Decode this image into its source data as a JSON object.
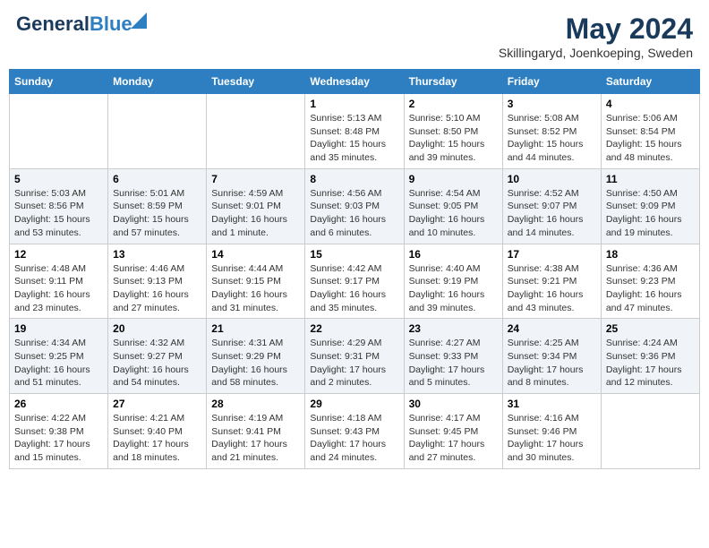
{
  "header": {
    "logo_general": "General",
    "logo_blue": "Blue",
    "month_title": "May 2024",
    "location": "Skillingaryd, Joenkoeping, Sweden"
  },
  "weekdays": [
    "Sunday",
    "Monday",
    "Tuesday",
    "Wednesday",
    "Thursday",
    "Friday",
    "Saturday"
  ],
  "weeks": [
    [
      {
        "day": "",
        "sunrise": "",
        "sunset": "",
        "daylight": ""
      },
      {
        "day": "",
        "sunrise": "",
        "sunset": "",
        "daylight": ""
      },
      {
        "day": "",
        "sunrise": "",
        "sunset": "",
        "daylight": ""
      },
      {
        "day": "1",
        "sunrise": "Sunrise: 5:13 AM",
        "sunset": "Sunset: 8:48 PM",
        "daylight": "Daylight: 15 hours and 35 minutes."
      },
      {
        "day": "2",
        "sunrise": "Sunrise: 5:10 AM",
        "sunset": "Sunset: 8:50 PM",
        "daylight": "Daylight: 15 hours and 39 minutes."
      },
      {
        "day": "3",
        "sunrise": "Sunrise: 5:08 AM",
        "sunset": "Sunset: 8:52 PM",
        "daylight": "Daylight: 15 hours and 44 minutes."
      },
      {
        "day": "4",
        "sunrise": "Sunrise: 5:06 AM",
        "sunset": "Sunset: 8:54 PM",
        "daylight": "Daylight: 15 hours and 48 minutes."
      }
    ],
    [
      {
        "day": "5",
        "sunrise": "Sunrise: 5:03 AM",
        "sunset": "Sunset: 8:56 PM",
        "daylight": "Daylight: 15 hours and 53 minutes."
      },
      {
        "day": "6",
        "sunrise": "Sunrise: 5:01 AM",
        "sunset": "Sunset: 8:59 PM",
        "daylight": "Daylight: 15 hours and 57 minutes."
      },
      {
        "day": "7",
        "sunrise": "Sunrise: 4:59 AM",
        "sunset": "Sunset: 9:01 PM",
        "daylight": "Daylight: 16 hours and 1 minute."
      },
      {
        "day": "8",
        "sunrise": "Sunrise: 4:56 AM",
        "sunset": "Sunset: 9:03 PM",
        "daylight": "Daylight: 16 hours and 6 minutes."
      },
      {
        "day": "9",
        "sunrise": "Sunrise: 4:54 AM",
        "sunset": "Sunset: 9:05 PM",
        "daylight": "Daylight: 16 hours and 10 minutes."
      },
      {
        "day": "10",
        "sunrise": "Sunrise: 4:52 AM",
        "sunset": "Sunset: 9:07 PM",
        "daylight": "Daylight: 16 hours and 14 minutes."
      },
      {
        "day": "11",
        "sunrise": "Sunrise: 4:50 AM",
        "sunset": "Sunset: 9:09 PM",
        "daylight": "Daylight: 16 hours and 19 minutes."
      }
    ],
    [
      {
        "day": "12",
        "sunrise": "Sunrise: 4:48 AM",
        "sunset": "Sunset: 9:11 PM",
        "daylight": "Daylight: 16 hours and 23 minutes."
      },
      {
        "day": "13",
        "sunrise": "Sunrise: 4:46 AM",
        "sunset": "Sunset: 9:13 PM",
        "daylight": "Daylight: 16 hours and 27 minutes."
      },
      {
        "day": "14",
        "sunrise": "Sunrise: 4:44 AM",
        "sunset": "Sunset: 9:15 PM",
        "daylight": "Daylight: 16 hours and 31 minutes."
      },
      {
        "day": "15",
        "sunrise": "Sunrise: 4:42 AM",
        "sunset": "Sunset: 9:17 PM",
        "daylight": "Daylight: 16 hours and 35 minutes."
      },
      {
        "day": "16",
        "sunrise": "Sunrise: 4:40 AM",
        "sunset": "Sunset: 9:19 PM",
        "daylight": "Daylight: 16 hours and 39 minutes."
      },
      {
        "day": "17",
        "sunrise": "Sunrise: 4:38 AM",
        "sunset": "Sunset: 9:21 PM",
        "daylight": "Daylight: 16 hours and 43 minutes."
      },
      {
        "day": "18",
        "sunrise": "Sunrise: 4:36 AM",
        "sunset": "Sunset: 9:23 PM",
        "daylight": "Daylight: 16 hours and 47 minutes."
      }
    ],
    [
      {
        "day": "19",
        "sunrise": "Sunrise: 4:34 AM",
        "sunset": "Sunset: 9:25 PM",
        "daylight": "Daylight: 16 hours and 51 minutes."
      },
      {
        "day": "20",
        "sunrise": "Sunrise: 4:32 AM",
        "sunset": "Sunset: 9:27 PM",
        "daylight": "Daylight: 16 hours and 54 minutes."
      },
      {
        "day": "21",
        "sunrise": "Sunrise: 4:31 AM",
        "sunset": "Sunset: 9:29 PM",
        "daylight": "Daylight: 16 hours and 58 minutes."
      },
      {
        "day": "22",
        "sunrise": "Sunrise: 4:29 AM",
        "sunset": "Sunset: 9:31 PM",
        "daylight": "Daylight: 17 hours and 2 minutes."
      },
      {
        "day": "23",
        "sunrise": "Sunrise: 4:27 AM",
        "sunset": "Sunset: 9:33 PM",
        "daylight": "Daylight: 17 hours and 5 minutes."
      },
      {
        "day": "24",
        "sunrise": "Sunrise: 4:25 AM",
        "sunset": "Sunset: 9:34 PM",
        "daylight": "Daylight: 17 hours and 8 minutes."
      },
      {
        "day": "25",
        "sunrise": "Sunrise: 4:24 AM",
        "sunset": "Sunset: 9:36 PM",
        "daylight": "Daylight: 17 hours and 12 minutes."
      }
    ],
    [
      {
        "day": "26",
        "sunrise": "Sunrise: 4:22 AM",
        "sunset": "Sunset: 9:38 PM",
        "daylight": "Daylight: 17 hours and 15 minutes."
      },
      {
        "day": "27",
        "sunrise": "Sunrise: 4:21 AM",
        "sunset": "Sunset: 9:40 PM",
        "daylight": "Daylight: 17 hours and 18 minutes."
      },
      {
        "day": "28",
        "sunrise": "Sunrise: 4:19 AM",
        "sunset": "Sunset: 9:41 PM",
        "daylight": "Daylight: 17 hours and 21 minutes."
      },
      {
        "day": "29",
        "sunrise": "Sunrise: 4:18 AM",
        "sunset": "Sunset: 9:43 PM",
        "daylight": "Daylight: 17 hours and 24 minutes."
      },
      {
        "day": "30",
        "sunrise": "Sunrise: 4:17 AM",
        "sunset": "Sunset: 9:45 PM",
        "daylight": "Daylight: 17 hours and 27 minutes."
      },
      {
        "day": "31",
        "sunrise": "Sunrise: 4:16 AM",
        "sunset": "Sunset: 9:46 PM",
        "daylight": "Daylight: 17 hours and 30 minutes."
      },
      {
        "day": "",
        "sunrise": "",
        "sunset": "",
        "daylight": ""
      }
    ]
  ]
}
